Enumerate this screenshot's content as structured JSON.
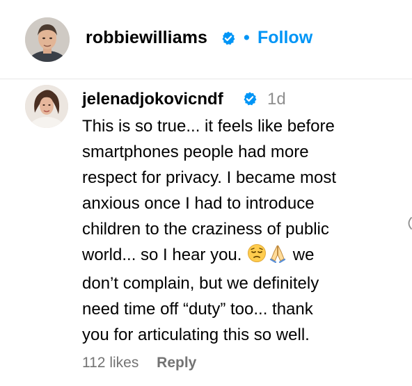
{
  "post_header": {
    "username": "robbiewilliams",
    "separator": "•",
    "follow_label": "Follow",
    "verified": true
  },
  "comment": {
    "author": "jelenadjokovicndf",
    "verified": true,
    "time": "1d",
    "text_lines": [
      "This is so true... it feels like before",
      "smartphones people had more",
      "respect for privacy. I became most",
      "anxious once I had to introduce",
      "children to the craziness of public",
      "world... so I hear you.",
      "don’t complain, but we definitely",
      "need time off “duty” too... thank",
      "you for articulating this so well."
    ],
    "line6_tail": " we",
    "likes": "112 likes",
    "reply_label": "Reply"
  },
  "icons": {
    "verified": "verified-badge-icon",
    "emoji_1": "pensive-face-emoji",
    "emoji_2": "folded-hands-emoji",
    "side": "chevron-left-icon"
  },
  "colors": {
    "link_blue": "#0095f6",
    "verified_blue": "#0095f6",
    "muted_gray": "#737373",
    "time_gray": "#8e8e8e"
  }
}
